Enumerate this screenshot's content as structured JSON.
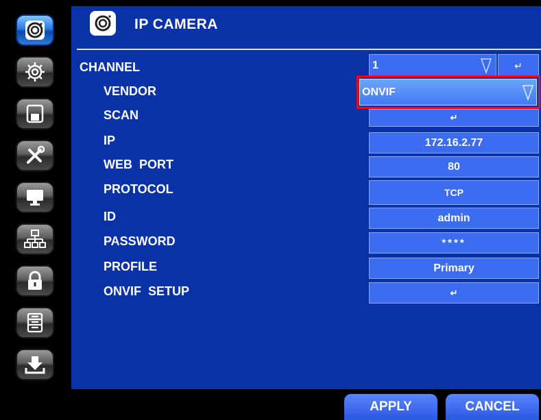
{
  "sidebar": {
    "items": [
      {
        "icon": "camera-icon",
        "active": true
      },
      {
        "icon": "gear-icon",
        "active": false
      },
      {
        "icon": "save-icon",
        "active": false
      },
      {
        "icon": "tools-icon",
        "active": false
      },
      {
        "icon": "monitor-icon",
        "active": false
      },
      {
        "icon": "network-icon",
        "active": false
      },
      {
        "icon": "lock-icon",
        "active": false
      },
      {
        "icon": "storage-icon",
        "active": false
      },
      {
        "icon": "download-icon",
        "active": false
      }
    ]
  },
  "header": {
    "title": "IP CAMERA",
    "icon": "camera-icon"
  },
  "form": {
    "channel": {
      "label": "CHANNEL",
      "value": "1",
      "enter": "↵"
    },
    "vendor": {
      "label": "VENDOR",
      "value": "ONVIF"
    },
    "scan": {
      "label": "SCAN",
      "value": "↵"
    },
    "ip": {
      "label": "IP",
      "value": "172.16.2.77"
    },
    "web_port": {
      "label": "WEB  PORT",
      "value": "80"
    },
    "protocol": {
      "label": "PROTOCOL",
      "value": "TCP"
    },
    "id": {
      "label": "ID",
      "value": "admin"
    },
    "password": {
      "label": "PASSWORD",
      "value": "****"
    },
    "profile": {
      "label": "PROFILE",
      "value": "Primary"
    },
    "onvif_setup": {
      "label": "ONVIF  SETUP",
      "value": "↵"
    }
  },
  "footer": {
    "apply_label": "APPLY",
    "cancel_label": "CANCEL"
  },
  "colors": {
    "panel": "#0832a6",
    "field": "#3c6cf0",
    "highlight": "#e0101a"
  }
}
